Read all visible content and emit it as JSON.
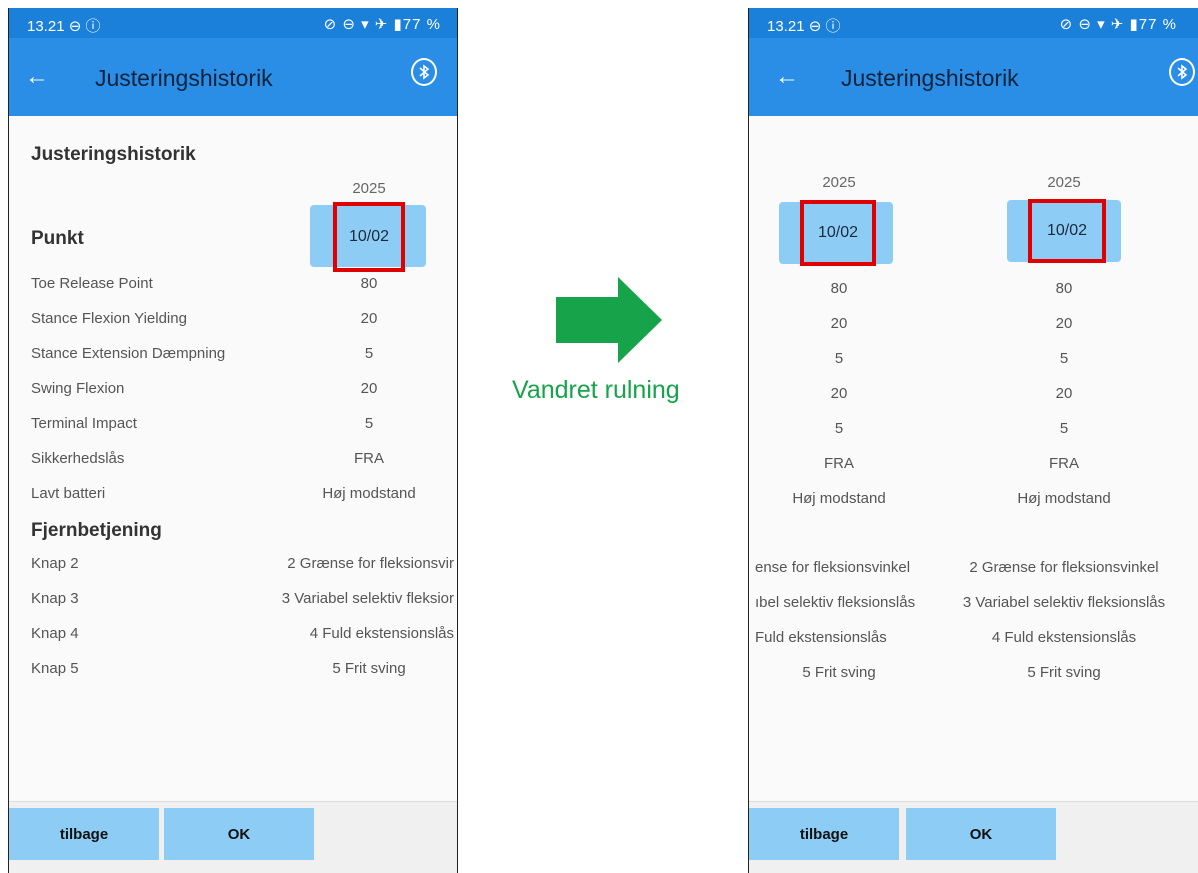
{
  "phone_left": {
    "status": {
      "time": "13.21 ⊖ ⓘ",
      "icons": "⊘ ⊖ ▾ ✈ ▮77 %"
    },
    "appbar": {
      "title": "Justeringshistorik"
    },
    "section_title": "Justeringshistorik",
    "year": "2025",
    "point_label": "Punkt",
    "date": "10/02",
    "rows": [
      {
        "label": "Toe Release Point",
        "value": "80"
      },
      {
        "label": "Stance Flexion Yielding",
        "value": "20"
      },
      {
        "label": "Stance Extension Dæmpning",
        "value": "5"
      },
      {
        "label": "Swing Flexion",
        "value": "20"
      },
      {
        "label": "Terminal Impact",
        "value": "5"
      },
      {
        "label": "Sikkerhedslås",
        "value": "FRA"
      },
      {
        "label": "Lavt batteri",
        "value": "Høj modstand"
      }
    ],
    "remote_title": "Fjernbetjening",
    "remote_rows": [
      {
        "label": "Knap 2",
        "value": "2 Grænse for fleksionsvir"
      },
      {
        "label": "Knap 3",
        "value": "3 Variabel selektiv fleksior"
      },
      {
        "label": "Knap 4",
        "value": "4 Fuld ekstensionslås"
      },
      {
        "label": "Knap 5",
        "value": "5 Frit sving"
      }
    ],
    "footer": {
      "back": "tilbage",
      "ok": "OK"
    }
  },
  "middle": {
    "caption": "Vandret rulning",
    "arrow_color": "#16a34a",
    "arrow_icon": "right-arrow-icon"
  },
  "phone_right": {
    "status": {
      "time": "13.21 ⊖ ⓘ",
      "icons": "⊘ ⊖ ▾ ✈ ▮77 %"
    },
    "appbar": {
      "title": "Justeringshistorik"
    },
    "col1": {
      "year": "2025",
      "date": "10/02",
      "values": [
        "80",
        "20",
        "5",
        "20",
        "5",
        "FRA",
        "Høj modstand"
      ],
      "remote": [
        "ense for fleksionsvinkel",
        "ıbel selektiv fleksionslås",
        "Fuld ekstensionslås",
        "5 Frit sving"
      ]
    },
    "col2": {
      "year": "2025",
      "date": "10/02",
      "values": [
        "80",
        "20",
        "5",
        "20",
        "5",
        "FRA",
        "Høj modstand"
      ],
      "remote": [
        "2 Grænse for fleksionsvinkel",
        "3 Variabel selektiv fleksionslås",
        "4 Fuld ekstensionslås",
        "5 Frit sving"
      ]
    },
    "footer": {
      "back": "tilbage",
      "ok": "OK"
    }
  }
}
